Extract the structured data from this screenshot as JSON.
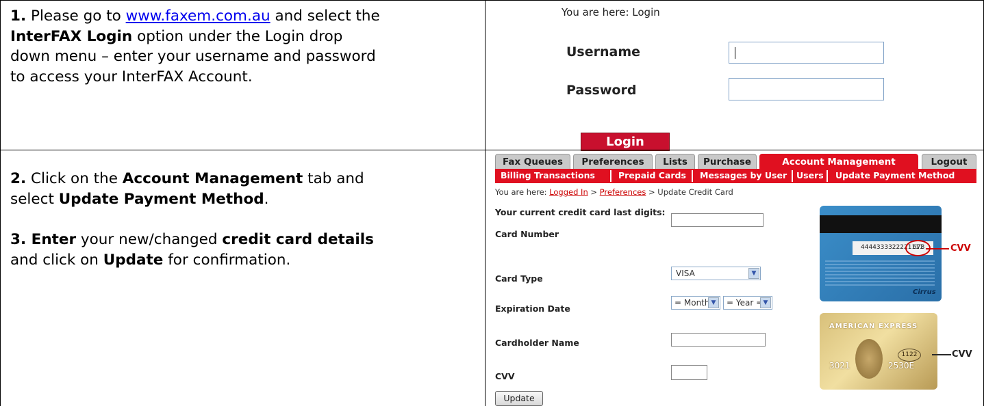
{
  "step1": {
    "num": "1.",
    "text_a": " Please go to ",
    "link": "www.faxem.com.au",
    "text_b": " and select the",
    "bold_a": "InterFAX Login",
    "text_c": " option under the Login drop",
    "line3": "down menu – enter your username and password",
    "line4": "to access your InterFAX Account."
  },
  "login": {
    "you_are_here": "You are here: Login",
    "username_label": "Username",
    "password_label": "Password",
    "username_value": "",
    "password_value": "",
    "button": "Login"
  },
  "step2": {
    "num": "2.",
    "text_a": " Click on the ",
    "bold_a": "Account Management",
    "text_b": " tab and",
    "text_c": "select ",
    "bold_b": "Update Payment Method",
    "text_d": "."
  },
  "step3": {
    "num": "3.",
    "bold_a": " Enter",
    "text_a": " your new/changed ",
    "bold_b": "credit card details",
    "text_b": "and click on ",
    "bold_c": "Update",
    "text_c": " for confirmation."
  },
  "account": {
    "tabs": [
      "Fax Queues",
      "Preferences",
      "Lists",
      "Purchase",
      "Account Management",
      "Logout"
    ],
    "active_tab": "Account Management",
    "subnav": [
      "Billing Transactions",
      "Prepaid Cards",
      "Messages by User",
      "Users",
      "Update Payment Method"
    ],
    "crumb_prefix": "You are here: ",
    "crumb_1": "Logged In",
    "crumb_sep": " > ",
    "crumb_2": "Preferences",
    "crumb_3": "Update Credit Card",
    "form_title": "Your current credit card last digits:",
    "card_number_label": "Card Number",
    "card_type_label": "Card Type",
    "card_type_value": "VISA",
    "expiration_label": "Expiration Date",
    "month_value": "= Month =",
    "year_value": "= Year =",
    "cardholder_label": "Cardholder Name",
    "cvv_label": "CVV",
    "update_button": "Update",
    "cvv_tag": "CVV",
    "visa_card_number": "4444333322221111",
    "visa_cvv_digits": "678",
    "visa_brand": "Cirrus",
    "amex_brand": "AMERICAN EXPRESS",
    "amex_cvv_digits": "1122",
    "amex_number_a": "3021",
    "amex_number_b": "2530E"
  },
  "colors": {
    "accent_red": "#e01020",
    "link_blue": "#0000ee"
  }
}
